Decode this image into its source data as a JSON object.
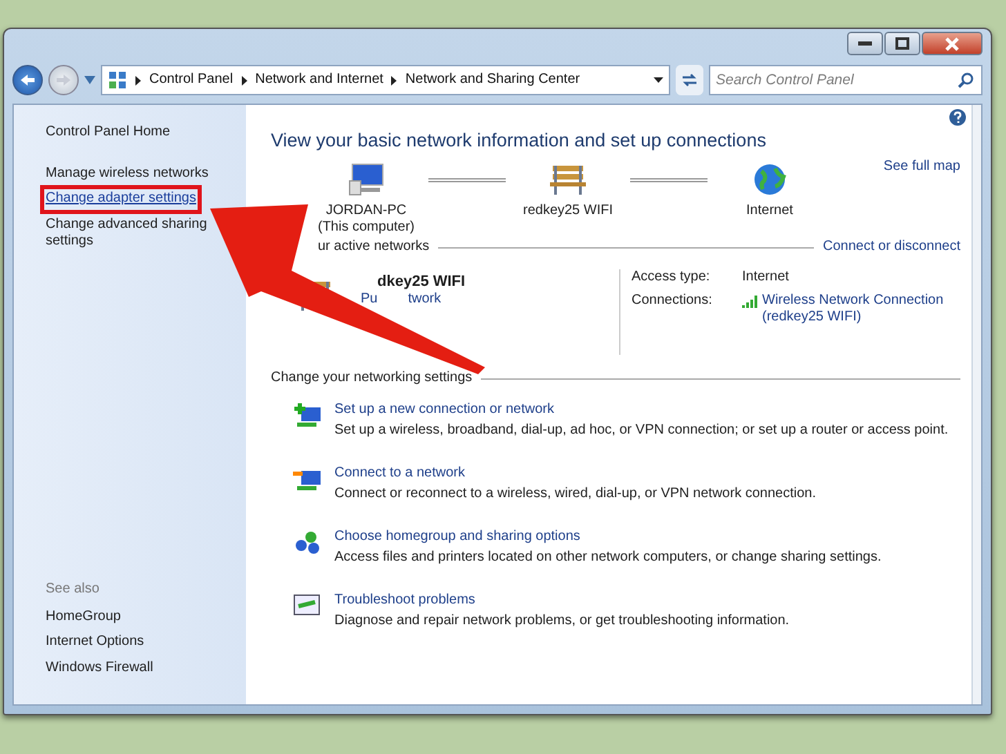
{
  "address_bar": {
    "breadcrumbs": [
      "Control Panel",
      "Network and Internet",
      "Network and Sharing Center"
    ]
  },
  "search": {
    "placeholder": "Search Control Panel"
  },
  "sidebar": {
    "items": [
      {
        "label": "Control Panel Home",
        "highlighted": false
      },
      {
        "label": "Manage wireless networks",
        "highlighted": false
      },
      {
        "label": "Change adapter settings",
        "highlighted": true
      },
      {
        "label": "Change advanced sharing settings",
        "highlighted": false
      }
    ],
    "see_also_title": "See also",
    "see_also": [
      "HomeGroup",
      "Internet Options",
      "Windows Firewall"
    ]
  },
  "main": {
    "title": "View your basic network information and set up connections",
    "see_full_map": "See full map",
    "map_nodes": [
      {
        "kind": "computer",
        "label": "JORDAN-PC\n(This computer)"
      },
      {
        "kind": "bench",
        "label": "redkey25 WIFI"
      },
      {
        "kind": "globe",
        "label": "Internet"
      }
    ],
    "active_title": "ur active networks",
    "connect_link": "Connect or disconnect",
    "network": {
      "name": "dkey25 WIFI",
      "type_left": "Pu",
      "type_right": "twork"
    },
    "access_label": "Access type:",
    "access_value": "Internet",
    "connections_label": "Connections:",
    "connections_value": "Wireless Network Connection\n(redkey25 WIFI)",
    "settings_title": "Change your networking settings",
    "tasks": [
      {
        "kind": "new",
        "title": "Set up a new connection or network",
        "desc": "Set up a wireless, broadband, dial-up, ad hoc, or VPN connection; or set up a router or access point."
      },
      {
        "kind": "connect",
        "title": "Connect to a network",
        "desc": "Connect or reconnect to a wireless, wired, dial-up, or VPN network connection."
      },
      {
        "kind": "homegroup",
        "title": "Choose homegroup and sharing options",
        "desc": "Access files and printers located on other network computers, or change sharing settings."
      },
      {
        "kind": "troubleshoot",
        "title": "Troubleshoot problems",
        "desc": "Diagnose and repair network problems, or get troubleshooting information."
      }
    ]
  }
}
